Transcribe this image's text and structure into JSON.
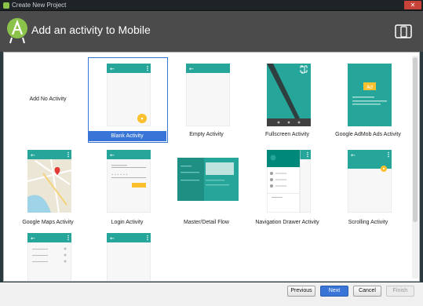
{
  "window": {
    "title": "Create New Project"
  },
  "header": {
    "title": "Add an activity to Mobile"
  },
  "activities": [
    {
      "label": "Add No Activity"
    },
    {
      "label": "Blank Activity"
    },
    {
      "label": "Empty Activity"
    },
    {
      "label": "Fullscreen Activity"
    },
    {
      "label": "Google AdMob Ads Activity"
    },
    {
      "label": "Google Maps Activity"
    },
    {
      "label": "Login Activity"
    },
    {
      "label": "Master/Detail Flow"
    },
    {
      "label": "Navigation Drawer Activity"
    },
    {
      "label": "Scrolling Activity"
    }
  ],
  "admob_badge": "Ad",
  "selected": "Blank Activity",
  "buttons": {
    "previous": "Previous",
    "next": "Next",
    "cancel": "Cancel",
    "finish": "Finish"
  },
  "colors": {
    "teal": "#26a69a",
    "teal_dark": "#00897b",
    "yellow": "#fbc02d",
    "selection": "#3875d7"
  }
}
